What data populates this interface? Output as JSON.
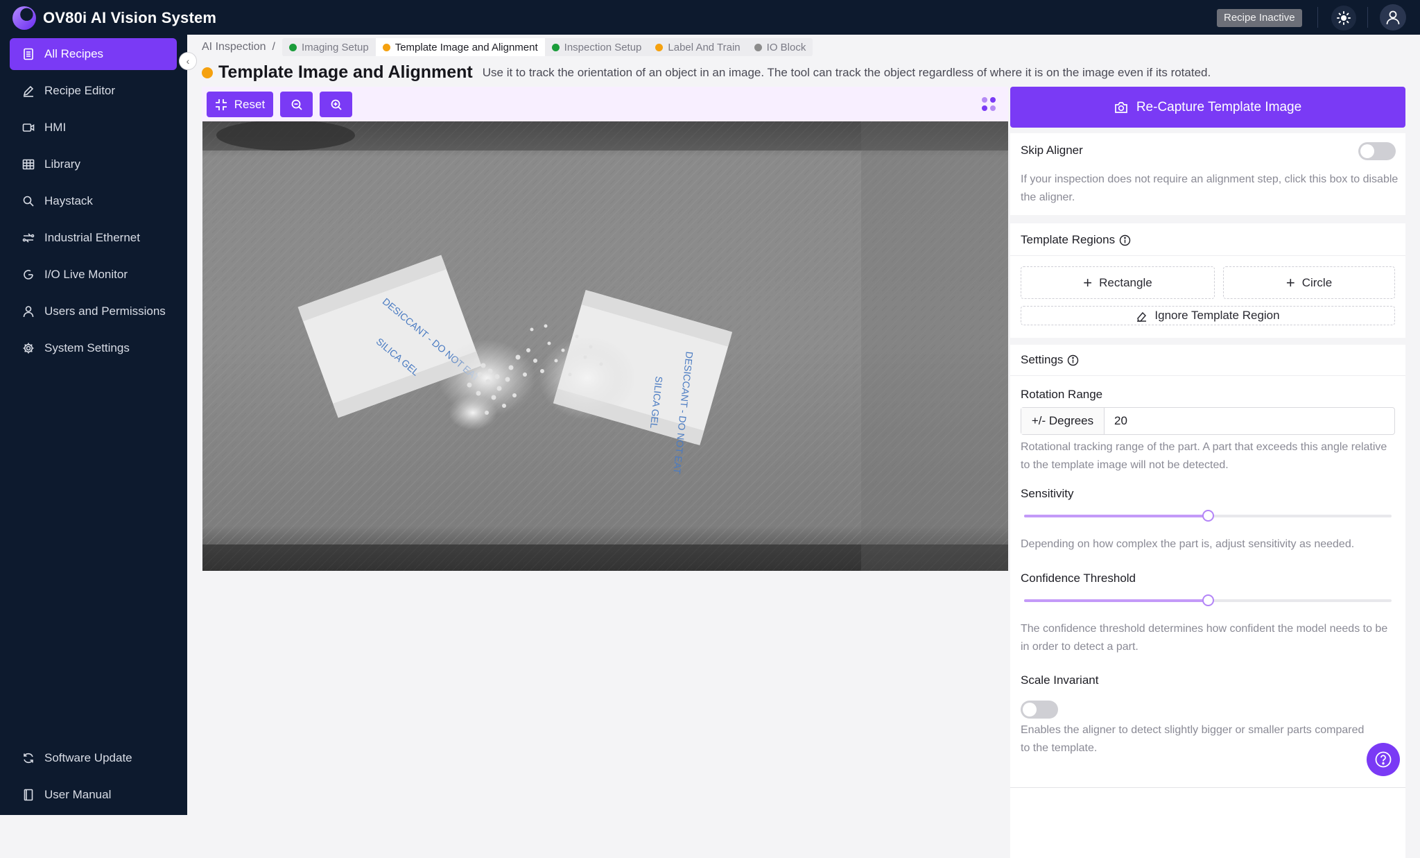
{
  "app": {
    "title": "OV80i AI Vision System",
    "recipe_status": "Recipe Inactive"
  },
  "sidebar": {
    "items": [
      {
        "label": "All Recipes",
        "icon": "document-icon"
      },
      {
        "label": "Recipe Editor",
        "icon": "pencil-icon"
      },
      {
        "label": "HMI",
        "icon": "video-icon"
      },
      {
        "label": "Library",
        "icon": "grid-icon"
      },
      {
        "label": "Haystack",
        "icon": "search-icon"
      },
      {
        "label": "Industrial Ethernet",
        "icon": "network-icon"
      },
      {
        "label": "I/O Live Monitor",
        "icon": "monitor-icon"
      },
      {
        "label": "Users and Permissions",
        "icon": "user-icon"
      },
      {
        "label": "System Settings",
        "icon": "gear-icon"
      }
    ],
    "footer": [
      {
        "label": "Software Update",
        "icon": "refresh-icon"
      },
      {
        "label": "User Manual",
        "icon": "book-icon"
      }
    ]
  },
  "breadcrumb": {
    "root": "AI Inspection",
    "separator": "/",
    "steps": [
      {
        "label": "Imaging Setup",
        "color": "#1a9c3a"
      },
      {
        "label": "Template Image and Alignment",
        "color": "#f5a10f"
      },
      {
        "label": "Inspection Setup",
        "color": "#1a9c3a"
      },
      {
        "label": "Label And Train",
        "color": "#f5a10f"
      },
      {
        "label": "IO Block",
        "color": "#8c8c8c"
      }
    ]
  },
  "page": {
    "title": "Template Image and Alignment",
    "description": "Use it to track the orientation of an object in an image. The tool can track the object regardless of where it is on the image even if its rotated."
  },
  "toolbar": {
    "reset_label": "Reset"
  },
  "panel": {
    "recapture_label": "Re-Capture Template Image",
    "skip_aligner": {
      "title": "Skip Aligner",
      "enabled": false,
      "help": "If your inspection does not require an alignment step, click this box to disable the aligner."
    },
    "template_regions": {
      "title": "Template Regions",
      "rectangle_label": "Rectangle",
      "circle_label": "Circle",
      "ignore_label": "Ignore Template Region"
    },
    "settings": {
      "title": "Settings",
      "rotation": {
        "title": "Rotation Range",
        "unit_label": "+/- Degrees",
        "value": "20",
        "help": "Rotational tracking range of the part. A part that exceeds this angle relative to the template image will not be detected."
      },
      "sensitivity": {
        "title": "Sensitivity",
        "value": 0.5,
        "help": "Depending on how complex the part is, adjust sensitivity as needed."
      },
      "confidence": {
        "title": "Confidence Threshold",
        "value": 0.5,
        "help": "The confidence threshold determines how confident the model needs to be in order to detect a part."
      },
      "scale_invariant": {
        "title": "Scale Invariant",
        "enabled": false,
        "help": "Enables the aligner to detect slightly bigger or smaller parts compared to the template."
      }
    }
  },
  "image": {
    "left_packet_text": [
      "DESICCANT - DO NOT EAT",
      "SILICA GEL",
      "DESICCANT"
    ],
    "right_packet_text": [
      "DESICCANT - DO NOT EAT",
      "SILICA GEL",
      "DO NOT EAT"
    ]
  }
}
